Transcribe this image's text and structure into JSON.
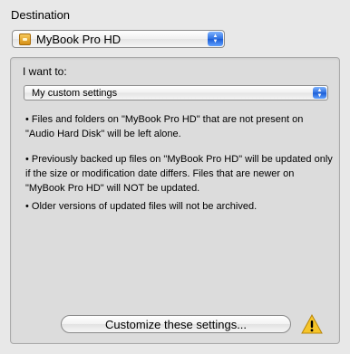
{
  "destination": {
    "label": "Destination",
    "selected": "MyBook Pro HD",
    "icon": "external-disk-icon"
  },
  "group": {
    "intent_label": "I want to:",
    "intent_selected": "My custom settings",
    "descriptions": [
      "• Files and folders on \"MyBook Pro HD\" that are not present on \"Audio Hard Disk\" will be left alone.",
      "• Previously backed up files on \"MyBook Pro HD\" will be updated only if the size or modification date differs. Files that are newer on \"MyBook Pro HD\" will NOT be updated.",
      "• Older versions of updated files will not be archived."
    ],
    "customize_button": "Customize these settings...",
    "warning_icon": "warning-icon"
  },
  "colors": {
    "background": "#e8e8e8",
    "group_background": "#dcdcdc",
    "stepper_blue": "#2d6fe0",
    "warning_yellow": "#f6c52a"
  }
}
